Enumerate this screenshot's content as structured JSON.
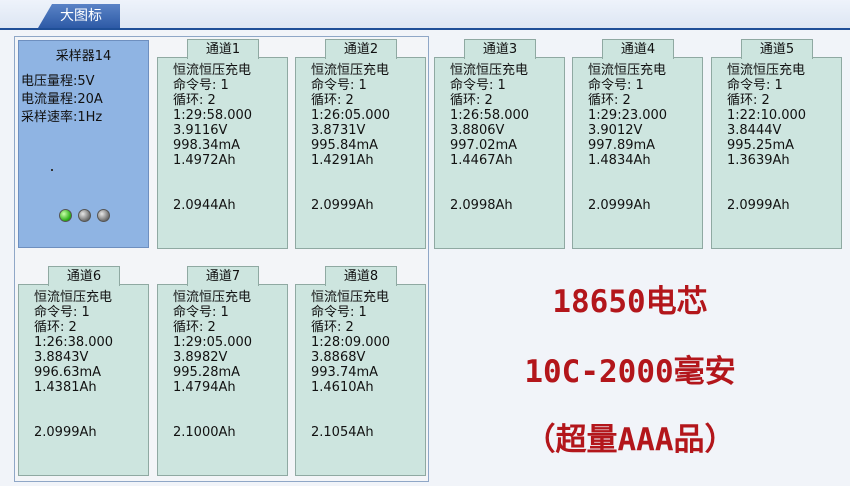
{
  "tab": {
    "label": "大图标"
  },
  "sampler": {
    "name": "采样器14",
    "voltage_range": "电压量程:5V",
    "current_range": "电流量程:20A",
    "sample_rate": "采样速率:1Hz",
    "leds": [
      "green",
      "gray",
      "gray"
    ]
  },
  "channels": [
    {
      "title": "通道1",
      "mode": "恒流恒压充电",
      "cmd": "命令号: 1",
      "cycle": "循环: 2",
      "time": "1:29:58.000",
      "voltage": "3.9116V",
      "current": "998.34mA",
      "cap1": "1.4972Ah",
      "cap2": "2.0944Ah"
    },
    {
      "title": "通道2",
      "mode": "恒流恒压充电",
      "cmd": "命令号: 1",
      "cycle": "循环: 2",
      "time": "1:26:05.000",
      "voltage": "3.8731V",
      "current": "995.84mA",
      "cap1": "1.4291Ah",
      "cap2": "2.0999Ah"
    },
    {
      "title": "通道3",
      "mode": "恒流恒压充电",
      "cmd": "命令号: 1",
      "cycle": "循环: 2",
      "time": "1:26:58.000",
      "voltage": "3.8806V",
      "current": "997.02mA",
      "cap1": "1.4467Ah",
      "cap2": "2.0998Ah"
    },
    {
      "title": "通道4",
      "mode": "恒流恒压充电",
      "cmd": "命令号: 1",
      "cycle": "循环: 2",
      "time": "1:29:23.000",
      "voltage": "3.9012V",
      "current": "997.89mA",
      "cap1": "1.4834Ah",
      "cap2": "2.0999Ah"
    },
    {
      "title": "通道5",
      "mode": "恒流恒压充电",
      "cmd": "命令号: 1",
      "cycle": "循环: 2",
      "time": "1:22:10.000",
      "voltage": "3.8444V",
      "current": "995.25mA",
      "cap1": "1.3639Ah",
      "cap2": "2.0999Ah"
    },
    {
      "title": "通道6",
      "mode": "恒流恒压充电",
      "cmd": "命令号: 1",
      "cycle": "循环: 2",
      "time": "1:26:38.000",
      "voltage": "3.8843V",
      "current": "996.63mA",
      "cap1": "1.4381Ah",
      "cap2": "2.0999Ah"
    },
    {
      "title": "通道7",
      "mode": "恒流恒压充电",
      "cmd": "命令号: 1",
      "cycle": "循环: 2",
      "time": "1:29:05.000",
      "voltage": "3.8982V",
      "current": "995.28mA",
      "cap1": "1.4794Ah",
      "cap2": "2.1000Ah"
    },
    {
      "title": "通道8",
      "mode": "恒流恒压充电",
      "cmd": "命令号: 1",
      "cycle": "循环: 2",
      "time": "1:28:09.000",
      "voltage": "3.8868V",
      "current": "993.74mA",
      "cap1": "1.4610Ah",
      "cap2": "2.1054Ah"
    }
  ],
  "annotation": {
    "line1": "18650电芯",
    "line2": "10C-2000毫安",
    "line3": "（超量AAA品）"
  }
}
